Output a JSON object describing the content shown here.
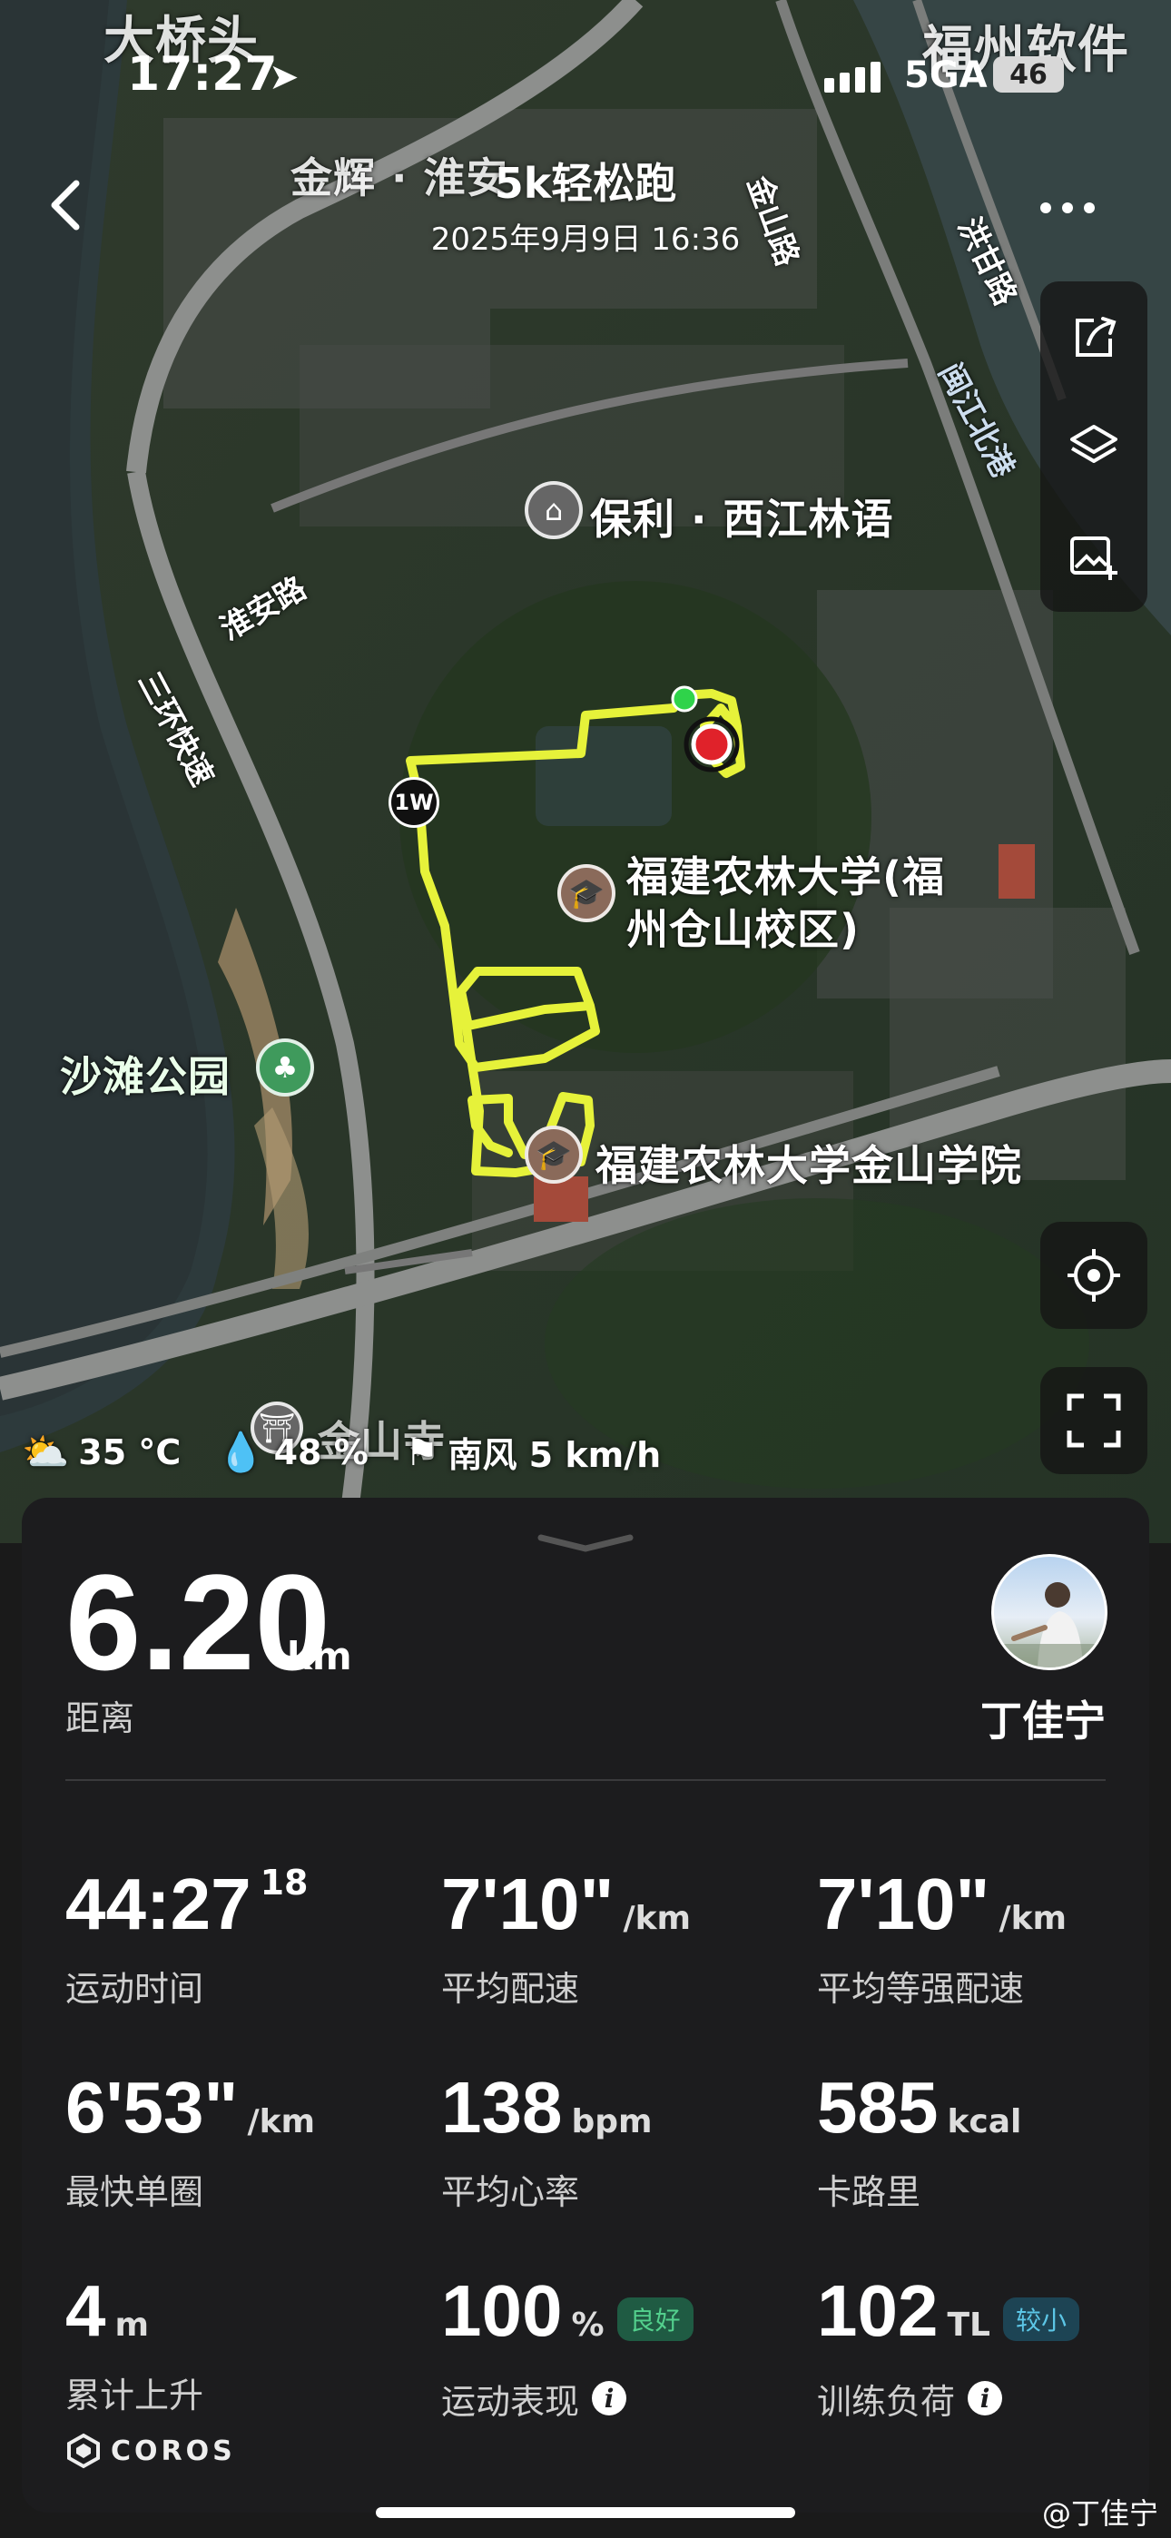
{
  "status_bar": {
    "time": "17:27",
    "network": "5GA",
    "battery": "46"
  },
  "header": {
    "title": "5k轻松跑",
    "date": "2025年9月9日 16:36"
  },
  "map": {
    "labels": {
      "top_left": "大桥头",
      "top_right": "福州软件",
      "jinhui": "金辉 · 淮安",
      "jinshan_road": "金山路",
      "hongtai_road": "洪甘路",
      "minjiang_port": "闽江北港",
      "poly": "保利 · 西江林语",
      "huaian_road": "淮安路",
      "third_ring": "三环快速",
      "univ": "福建农林大学(福州仓山校区)",
      "univ_line1": "福建农林大学(福",
      "univ_line2": "州仓山校区)",
      "beach_park": "沙滩公园",
      "jinshan_college": "福建农林大学金山学院",
      "jinshan_temple": "金山寺",
      "lap_marker": "1W"
    }
  },
  "weather": {
    "temp": "35 °C",
    "humidity": "48 %",
    "wind": "南风 5 km/h"
  },
  "summary": {
    "distance": "6.20",
    "distance_unit": "km",
    "distance_label": "距离",
    "user": "丁佳宁"
  },
  "stats": [
    {
      "value": "44:27",
      "sup": "18",
      "unit": "",
      "label": "运动时间"
    },
    {
      "value": "7'10\"",
      "unit": "/km",
      "label": "平均配速"
    },
    {
      "value": "7'10\"",
      "unit": "/km",
      "label": "平均等强配速"
    },
    {
      "value": "6'53\"",
      "unit": "/km",
      "label": "最快单圈"
    },
    {
      "value": "138",
      "unit": "bpm",
      "label": "平均心率"
    },
    {
      "value": "585",
      "unit": "kcal",
      "label": "卡路里"
    },
    {
      "value": "4",
      "unit": "m",
      "label": "累计上升"
    },
    {
      "value": "100",
      "unit": "%",
      "badge": "良好",
      "label": "运动表现"
    },
    {
      "value": "102",
      "unit": "TL",
      "badge": "较小",
      "label": "训练负荷"
    }
  ],
  "brand": "COROS",
  "watermark": "@丁佳宁",
  "colors": {
    "route": "#e6f23a",
    "card_bg": "#1c1c1e",
    "badge_green": "#53d08d",
    "badge_blue": "#5cc6e6"
  }
}
